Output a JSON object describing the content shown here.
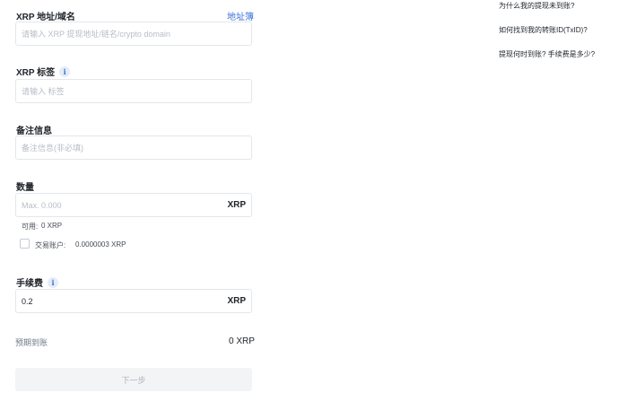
{
  "form": {
    "address": {
      "label": "XRP 地址/域名",
      "address_book_link": "地址簿",
      "placeholder": "请输入 XRP 提现地址/链名/crypto domain",
      "value": ""
    },
    "tag": {
      "label": "XRP 标签",
      "info_icon": "i",
      "placeholder": "请输入 标签",
      "value": ""
    },
    "memo": {
      "label": "备注信息",
      "placeholder": "备注信息(非必填)",
      "value": ""
    },
    "amount": {
      "label": "数量",
      "placeholder": "Max. 0.000",
      "value": "",
      "currency": "XRP",
      "available_label": "可用:",
      "available_value": "0 XRP",
      "trading_account_label": "交易账户:",
      "trading_account_value": "0.0000003 XRP"
    },
    "fee": {
      "label": "手续费",
      "info_icon": "i",
      "value": "0.2",
      "currency": "XRP"
    },
    "expected": {
      "label": "预期到账",
      "value": "0 XRP"
    },
    "next_button": "下一步"
  },
  "faq": [
    "为什么我的提现未到账?",
    "如何找到我的转账ID(TxID)?",
    "提现何时到账? 手续费是多少?"
  ]
}
